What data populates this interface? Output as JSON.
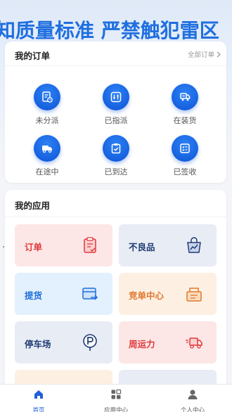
{
  "banner": {
    "slogan": "知质量标准 严禁触犯雷区"
  },
  "orders": {
    "title": "我的订单",
    "more_label": "全部订单",
    "statuses": [
      {
        "label": "未分派",
        "icon": "document-clock-icon"
      },
      {
        "label": "已指派",
        "icon": "sliders-icon"
      },
      {
        "label": "在装货",
        "icon": "box-truck-icon"
      },
      {
        "label": "在途中",
        "icon": "delivery-truck-icon"
      },
      {
        "label": "已到达",
        "icon": "clipboard-check-icon"
      },
      {
        "label": "已签收",
        "icon": "signed-list-icon"
      }
    ]
  },
  "apps": {
    "title": "我的应用",
    "tiles": [
      {
        "label": "订单",
        "icon": "clipboard-icon",
        "bg": "#fde6e6",
        "fg": "#e0383a"
      },
      {
        "label": "不良品",
        "icon": "chart-bag-icon",
        "bg": "#e8ecf5",
        "fg": "#1f3b73"
      },
      {
        "label": "提货",
        "icon": "card-arrow-icon",
        "bg": "#e3f0fd",
        "fg": "#1e6fd9"
      },
      {
        "label": "竞单中心",
        "icon": "auction-box-icon",
        "bg": "#fdf0e3",
        "fg": "#e0782b"
      },
      {
        "label": "停车场",
        "icon": "parking-icon",
        "bg": "#e8ecf5",
        "fg": "#1f3b73"
      },
      {
        "label": "周运力",
        "icon": "fast-truck-icon",
        "bg": "#fde6e6",
        "fg": "#e0383a"
      }
    ]
  },
  "tabbar": {
    "items": [
      {
        "label": "首页",
        "icon": "home-icon",
        "active": true
      },
      {
        "label": "应用中心",
        "icon": "apps-grid-icon",
        "active": false
      },
      {
        "label": "个人中心",
        "icon": "person-icon",
        "active": false
      }
    ]
  }
}
